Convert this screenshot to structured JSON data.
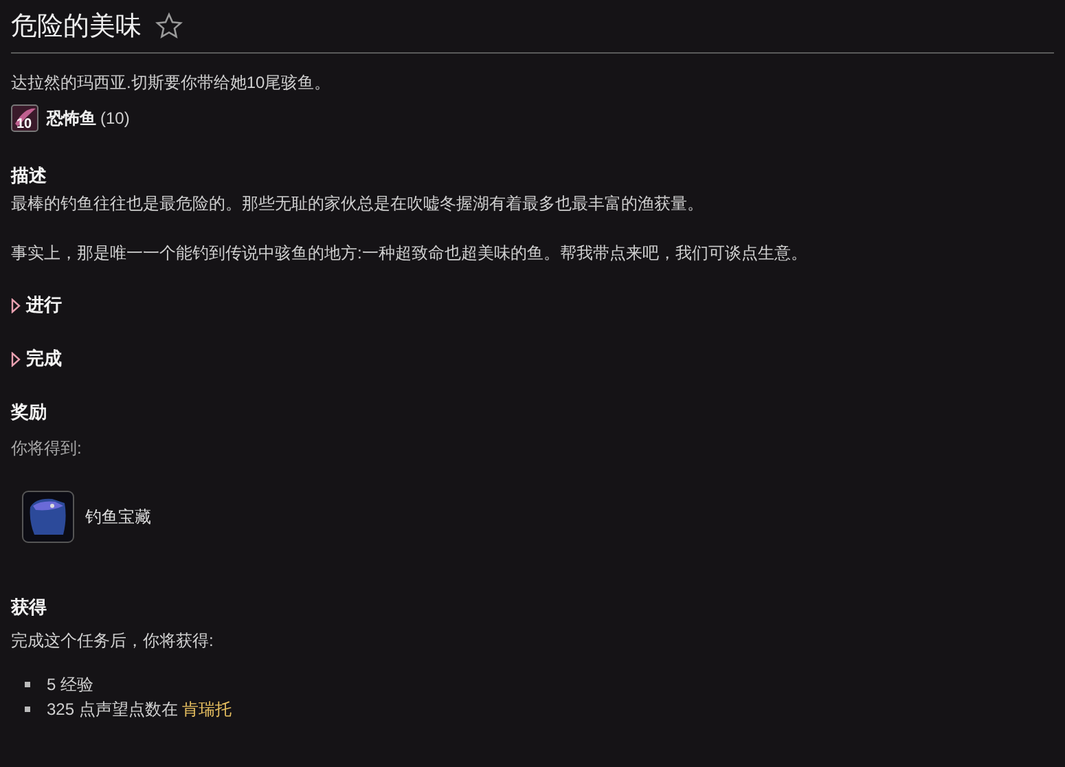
{
  "title": "危险的美味",
  "favorite": false,
  "objective": "达拉然的玛西亚.切斯要你带给她10尾骇鱼。",
  "required_items": [
    {
      "name": "恐怖鱼",
      "count": "(10)",
      "icon_badge": "10"
    }
  ],
  "description": {
    "heading": "描述",
    "paragraphs": [
      "最棒的钓鱼往往也是最危险的。那些无耻的家伙总是在吹嘘冬握湖有着最多也最丰富的渔获量。",
      "事实上，那是唯一一个能钓到传说中骇鱼的地方:一种超致命也超美味的鱼。帮我带点来吧，我们可谈点生意。"
    ]
  },
  "collapsibles": [
    {
      "label": "进行",
      "expanded": false
    },
    {
      "label": "完成",
      "expanded": false
    }
  ],
  "rewards": {
    "heading": "奖励",
    "intro": "你将得到:",
    "items": [
      {
        "name": "钓鱼宝藏"
      }
    ]
  },
  "gains": {
    "heading": "获得",
    "intro": "完成这个任务后，你将获得:",
    "items": [
      {
        "text": "5 经验"
      },
      {
        "text": "325 点声望点数在",
        "link": "肯瑞托"
      }
    ]
  }
}
